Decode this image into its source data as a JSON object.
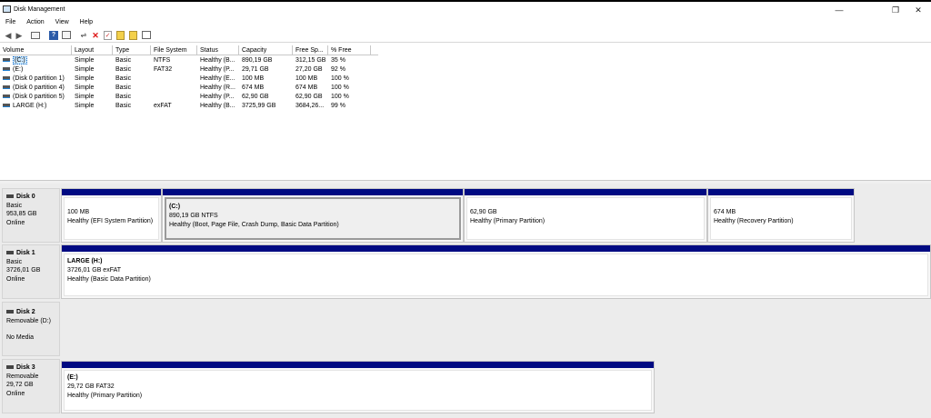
{
  "window": {
    "title": "Disk Management",
    "minimize": "—",
    "restore": "❐",
    "close": "✕"
  },
  "menu": [
    "File",
    "Action",
    "View",
    "Help"
  ],
  "toolbar_icons": [
    "back-icon",
    "forward-icon",
    "console-tree-icon",
    "help-icon",
    "properties-icon",
    "connect-drive-icon",
    "delete-icon",
    "check-icon",
    "format-icon",
    "rescan-icon",
    "view-icon"
  ],
  "volume_list": {
    "columns": [
      "Volume",
      "Layout",
      "Type",
      "File System",
      "Status",
      "Capacity",
      "Free Sp...",
      "% Free"
    ],
    "rows": [
      [
        "(C:)",
        "Simple",
        "Basic",
        "NTFS",
        "Healthy (B...",
        "890,19 GB",
        "312,15 GB",
        "35 %"
      ],
      [
        "(E:)",
        "Simple",
        "Basic",
        "FAT32",
        "Healthy (P...",
        "29,71 GB",
        "27,20 GB",
        "92 %"
      ],
      [
        "(Disk 0 partition 1)",
        "Simple",
        "Basic",
        "",
        "Healthy (E...",
        "100 MB",
        "100 MB",
        "100 %"
      ],
      [
        "(Disk 0 partition 4)",
        "Simple",
        "Basic",
        "",
        "Healthy (R...",
        "674 MB",
        "674 MB",
        "100 %"
      ],
      [
        "(Disk 0 partition 5)",
        "Simple",
        "Basic",
        "",
        "Healthy (P...",
        "62,90 GB",
        "62,90 GB",
        "100 %"
      ],
      [
        "LARGE (H:)",
        "Simple",
        "Basic",
        "exFAT",
        "Healthy (B...",
        "3725,99 GB",
        "3684,26...",
        "99 %"
      ]
    ]
  },
  "disks": [
    {
      "name": "Disk 0",
      "type": "Basic",
      "size": "953,85 GB",
      "status": "Online",
      "partitions": [
        {
          "name": "",
          "size": "100 MB",
          "status": "Healthy (EFI System Partition)"
        },
        {
          "name": "(C:)",
          "size": "890,19 GB NTFS",
          "status": "Healthy (Boot, Page File, Crash Dump, Basic Data Partition)"
        },
        {
          "name": "",
          "size": "62,90 GB",
          "status": "Healthy (Primary Partition)"
        },
        {
          "name": "",
          "size": "674 MB",
          "status": "Healthy (Recovery Partition)"
        }
      ]
    },
    {
      "name": "Disk 1",
      "type": "Basic",
      "size": "3726,01 GB",
      "status": "Online",
      "partitions": [
        {
          "name": "LARGE  (H:)",
          "size": "3726,01 GB exFAT",
          "status": "Healthy (Basic Data Partition)"
        }
      ]
    },
    {
      "name": "Disk 2",
      "type": "Removable (D:)",
      "size": "",
      "status": "No Media",
      "partitions": []
    },
    {
      "name": "Disk 3",
      "type": "Removable",
      "size": "29,72 GB",
      "status": "Online",
      "partitions": [
        {
          "name": "(E:)",
          "size": "29,72 GB FAT32",
          "status": "Healthy (Primary Partition)"
        }
      ]
    }
  ]
}
